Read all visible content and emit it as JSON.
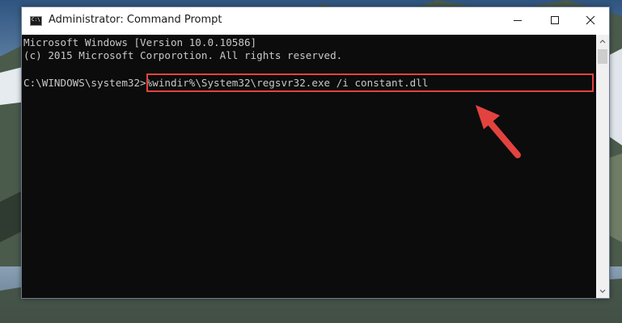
{
  "window": {
    "title": "Administrator: Command Prompt",
    "app_icon_glyph": "C:\\",
    "controls": {
      "minimize": "minimize-icon",
      "maximize": "maximize-icon",
      "close": "close-icon"
    }
  },
  "console": {
    "lines": [
      "Microsoft Windows [Version 10.0.10586]",
      "(c) 2015 Microsoft Corporotion. All rights reserved."
    ],
    "prompt": "C:\\WINDOWS\\system32>",
    "command": "%windir%\\System32\\regsvr32.exe /i constant.dll"
  },
  "annotation": {
    "highlight_color": "#e3433f",
    "arrow_color": "#e3433f"
  },
  "colors": {
    "console_background": "#0c0c0c",
    "console_text": "#c8c8c8",
    "titlebar": "#ffffff"
  }
}
